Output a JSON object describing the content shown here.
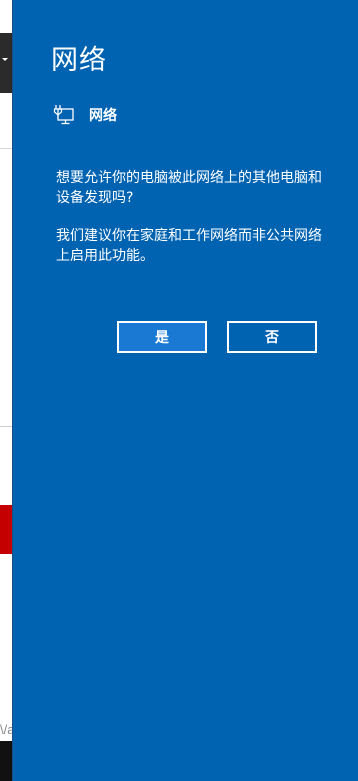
{
  "panel": {
    "title": "网络",
    "network_name": "网络",
    "question": "想要允许你的电脑被此网络上的其他电脑和设备发现吗?",
    "advice": "我们建议你在家庭和工作网络而非公共网络上启用此功能。",
    "yes_label": "是",
    "no_label": "否",
    "network_icon": "network-icon"
  },
  "background": {
    "partial_text": "\\/a"
  },
  "colors": {
    "panel_bg": "#0063b1",
    "yes_button_bg": "#1a7ad3",
    "text": "#ffffff"
  }
}
